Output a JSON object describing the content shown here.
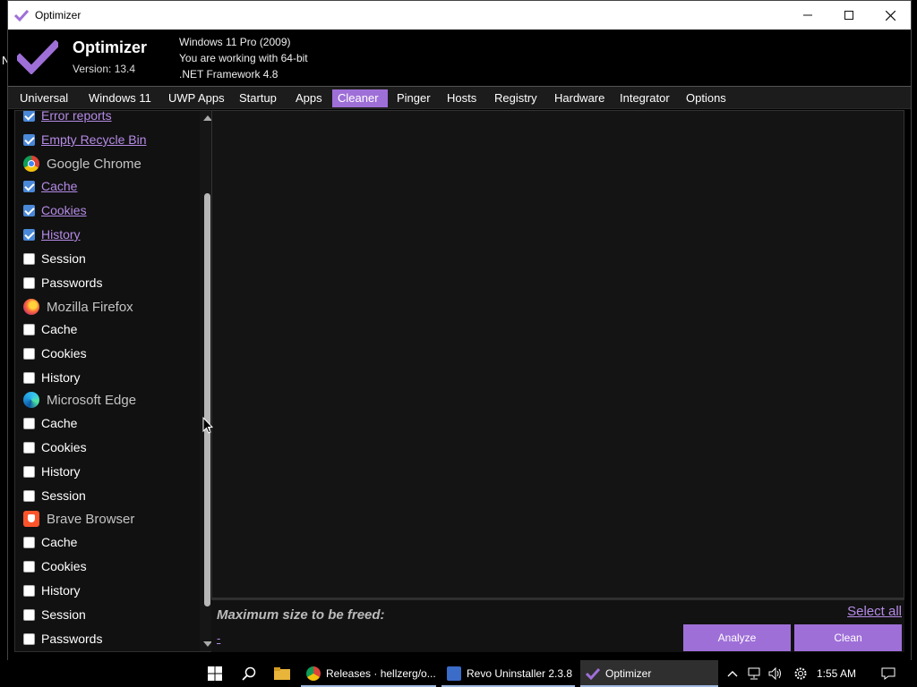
{
  "window": {
    "title": "Optimizer"
  },
  "header": {
    "app_name": "Optimizer",
    "version": "Version: 13.4",
    "sysinfo": [
      "Windows 11 Pro (2009)",
      "You are working with 64-bit",
      ".NET Framework 4.8"
    ]
  },
  "tabs": [
    "Universal",
    "Windows 11",
    "UWP Apps",
    "Startup",
    "Apps",
    "Cleaner",
    "Pinger",
    "Hosts",
    "Registry",
    "Hardware",
    "Integrator",
    "Options"
  ],
  "active_tab": "Cleaner",
  "cleaner": {
    "items": {
      "error_reports": "Error reports",
      "empty_recycle_bin": "Empty Recycle Bin",
      "chrome_group": "Google Chrome",
      "chrome_cache": "Cache",
      "chrome_cookies": "Cookies",
      "chrome_history": "History",
      "chrome_session": "Session",
      "chrome_passwords": "Passwords",
      "firefox_group": "Mozilla Firefox",
      "firefox_cache": "Cache",
      "firefox_cookies": "Cookies",
      "firefox_history": "History",
      "edge_group": "Microsoft Edge",
      "edge_cache": "Cache",
      "edge_cookies": "Cookies",
      "edge_history": "History",
      "edge_session": "Session",
      "brave_group": "Brave Browser",
      "brave_cache": "Cache",
      "brave_cookies": "Cookies",
      "brave_history": "History",
      "brave_session": "Session",
      "brave_passwords": "Passwords"
    },
    "max_size_label": "Maximum size to be freed:",
    "size_value": "-",
    "select_all": "Select all",
    "analyze": "Analyze",
    "clean": "Clean"
  },
  "taskbar": {
    "apps": [
      "Releases · hellzerg/o...",
      "Revo Uninstaller 2.3.8",
      "Optimizer"
    ],
    "clock": "1:55 AM"
  },
  "desktop_char": "N",
  "colors": {
    "accent": "#9f6fd8",
    "link": "#b58be6",
    "checkbox": "#4a88d8"
  }
}
